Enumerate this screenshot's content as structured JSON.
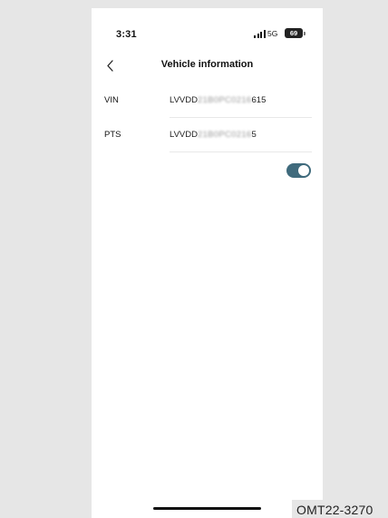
{
  "status_bar": {
    "time": "3:31",
    "network": "5G",
    "battery": "69",
    "signal_icon": "signal-bars-icon"
  },
  "nav": {
    "back_icon": "chevron-left-icon",
    "title": "Vehicle information"
  },
  "rows": [
    {
      "label": "VIN",
      "value_prefix": "LVVDD",
      "value_hidden": "21B0PC0216",
      "value_suffix": "615"
    },
    {
      "label": "PTS",
      "value_prefix": "LVVDD",
      "value_hidden": "21B0PC0216",
      "value_suffix": "5"
    }
  ],
  "toggle": {
    "on": true,
    "color": "#3f6a7c"
  },
  "caption": "OMT22-3270"
}
